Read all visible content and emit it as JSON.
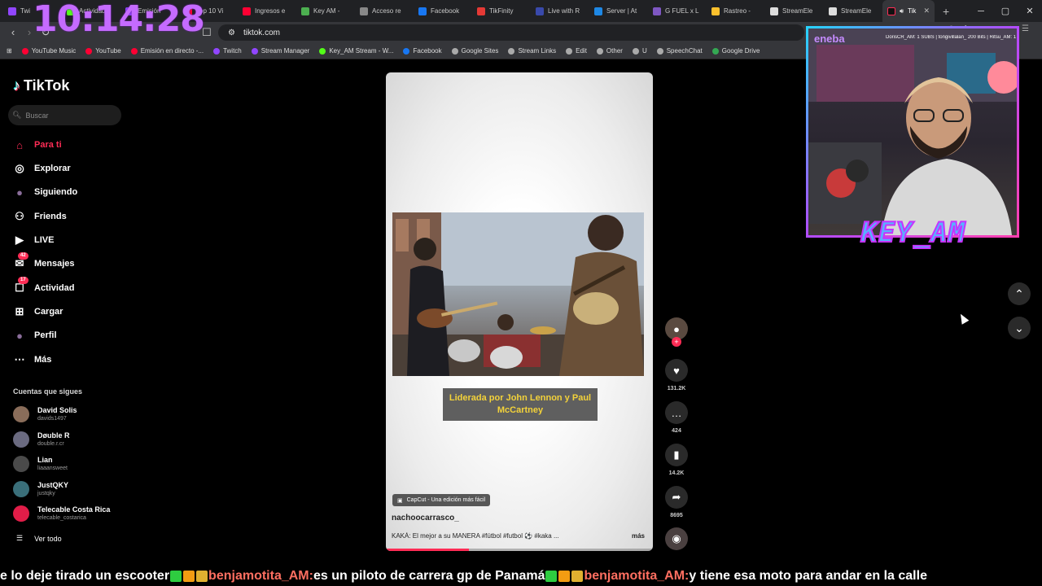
{
  "browser": {
    "tabs": [
      {
        "label": "Twi",
        "color": "#9146ff"
      },
      {
        "label": "Actividad",
        "color": "#53fc18"
      },
      {
        "label": "Emisión",
        "color": "#9146ff"
      },
      {
        "label": "Top 10 Vi",
        "color": "#ff0033"
      },
      {
        "label": "Ingresos e",
        "color": "#ff0033"
      },
      {
        "label": "Key AM -",
        "color": "#4caf50"
      },
      {
        "label": "Acceso re",
        "color": "#888888"
      },
      {
        "label": "Facebook",
        "color": "#1877f2"
      },
      {
        "label": "TikFinity",
        "color": "#e53935"
      },
      {
        "label": "Live with R",
        "color": "#3949ab"
      },
      {
        "label": "Server | At",
        "color": "#1e88e5"
      },
      {
        "label": "G FUEL x L",
        "color": "#7e57c2"
      },
      {
        "label": "Rastreo -",
        "color": "#fbc02d"
      },
      {
        "label": "StreamEle",
        "color": "#dddddd"
      },
      {
        "label": "StreamEle",
        "color": "#dddddd"
      }
    ],
    "active_tab": {
      "label": "Tik",
      "close": "✕"
    },
    "new_tab": "+",
    "window_controls": {
      "minimize": "─",
      "maximize": "▢",
      "close": "✕"
    },
    "url": "tiktok.com",
    "bookmarks": [
      {
        "label": "YouTube Music",
        "color": "#ff0033"
      },
      {
        "label": "YouTube",
        "color": "#ff0033"
      },
      {
        "label": "Emisión en directo -...",
        "color": "#ff0033"
      },
      {
        "label": "Twitch",
        "color": "#9146ff"
      },
      {
        "label": "Stream Manager",
        "color": "#9146ff"
      },
      {
        "label": "Key_AM Stream - W...",
        "color": "#53fc18"
      },
      {
        "label": "Facebook",
        "color": "#1877f2"
      },
      {
        "label": "Google Sites",
        "color": "#aaaaaa"
      },
      {
        "label": "Stream Links",
        "color": "#aaaaaa"
      },
      {
        "label": "Edit",
        "color": "#aaaaaa"
      },
      {
        "label": "Other",
        "color": "#aaaaaa"
      },
      {
        "label": "U",
        "color": "#aaaaaa"
      },
      {
        "label": "SpeechChat",
        "color": "#aaaaaa"
      },
      {
        "label": "Google Drive",
        "color": "#34a853"
      }
    ]
  },
  "overlay": {
    "clock": "10:14:28",
    "cam_brand": "eneba",
    "cam_ticker": "DorisCR_AM: 1 SUBS | tongivillalan_ 200 Bits | Ritsu_AM: 1 SUBS | sol_andi: 30",
    "cam_name": "KEY_AM"
  },
  "sidebar": {
    "logo": "TikTok",
    "search_placeholder": "Buscar",
    "nav": [
      {
        "label": "Para ti",
        "icon": "home",
        "active": true
      },
      {
        "label": "Explorar",
        "icon": "compass"
      },
      {
        "label": "Siguiendo",
        "icon": "avatar"
      },
      {
        "label": "Friends",
        "icon": "friends"
      },
      {
        "label": "LIVE",
        "icon": "live"
      },
      {
        "label": "Mensajes",
        "icon": "messages",
        "badge": "42"
      },
      {
        "label": "Actividad",
        "icon": "activity",
        "badge": "17"
      },
      {
        "label": "Cargar",
        "icon": "upload"
      },
      {
        "label": "Perfil",
        "icon": "profile"
      },
      {
        "label": "Más",
        "icon": "more"
      }
    ],
    "following_title": "Cuentas que sigues",
    "accounts": [
      {
        "name": "David Solis",
        "handle": "davids1497",
        "color": "#8a6d5a"
      },
      {
        "name": "Døuble R",
        "handle": "double.r.cr",
        "color": "#6a6a80"
      },
      {
        "name": "Lian",
        "handle": "liaaansweet",
        "color": "#4a4a4a"
      },
      {
        "name": "JustQKY",
        "handle": "justqky",
        "color": "#3a6f7a"
      },
      {
        "name": "Telecable Costa Rica",
        "handle": "telecable_costarica",
        "color": "#e11d48"
      }
    ],
    "see_all": "Ver todo"
  },
  "video": {
    "subtitle": "Liderada por John Lennon y Paul McCartney",
    "capcut": "CapCut - Una edición más fácil",
    "username": "nachoocarrasco_",
    "caption": "KAKÁ: El mejor a su MANERA #fútbol #futbol ⚽ #kaka ...",
    "more": "más",
    "progress": 0.31
  },
  "actions": {
    "likes": "131.2K",
    "comments": "424",
    "saves": "14.2K",
    "shares": "8695"
  },
  "ticker": [
    {
      "type": "msg",
      "text": "e lo deje tirado un escooter "
    },
    {
      "type": "user",
      "text": "benjamotita_AM:"
    },
    {
      "type": "msg",
      "text": " es un piloto de carrera gp de Panamá "
    },
    {
      "type": "user",
      "text": "benjamotita_AM:"
    },
    {
      "type": "msg",
      "text": " y tiene esa moto para andar en la calle"
    }
  ]
}
